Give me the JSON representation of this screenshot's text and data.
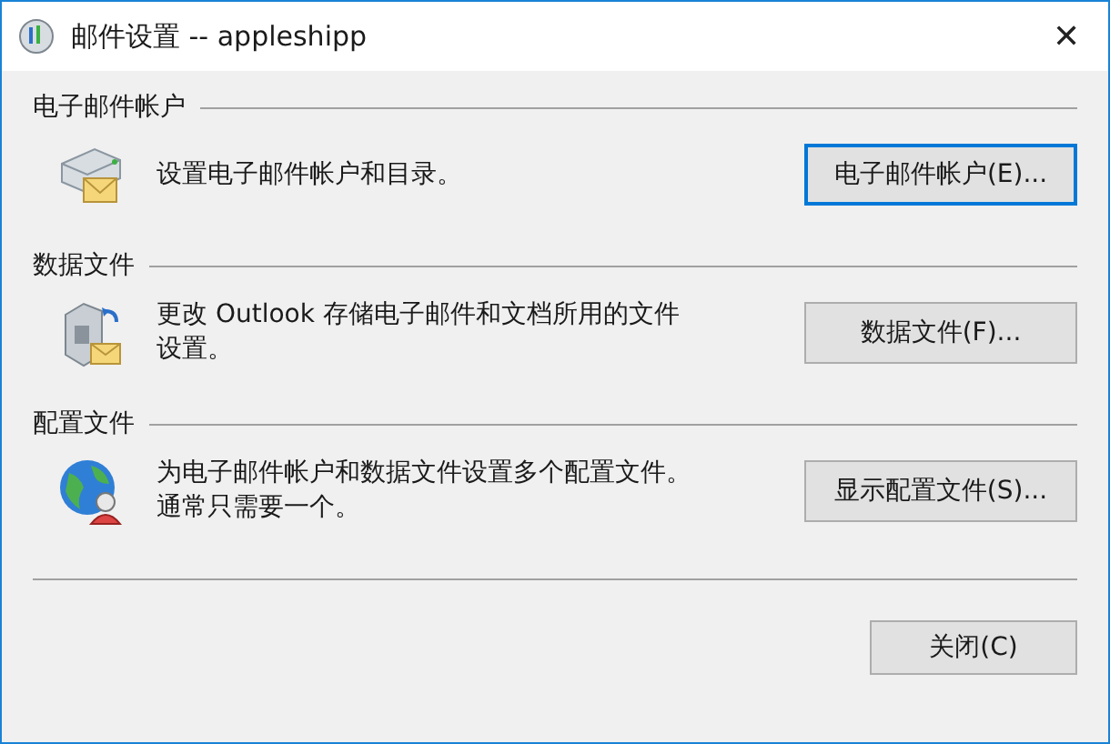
{
  "window": {
    "title": "邮件设置 --  appleshipp",
    "close": "✕"
  },
  "sections": [
    {
      "kind": "email",
      "heading": "电子邮件帐户",
      "description": "设置电子邮件帐户和目录。",
      "button": "电子邮件帐户(E)...",
      "focused": true
    },
    {
      "kind": "data",
      "heading": "数据文件",
      "description": "更改 Outlook 存储电子邮件和文档所用的文件设置。",
      "button": "数据文件(F)...",
      "focused": false
    },
    {
      "kind": "profile",
      "heading": "配置文件",
      "description": "为电子邮件帐户和数据文件设置多个配置文件。通常只需要一个。",
      "button": "显示配置文件(S)...",
      "focused": false
    }
  ],
  "footer": {
    "button": "关闭(C)"
  }
}
